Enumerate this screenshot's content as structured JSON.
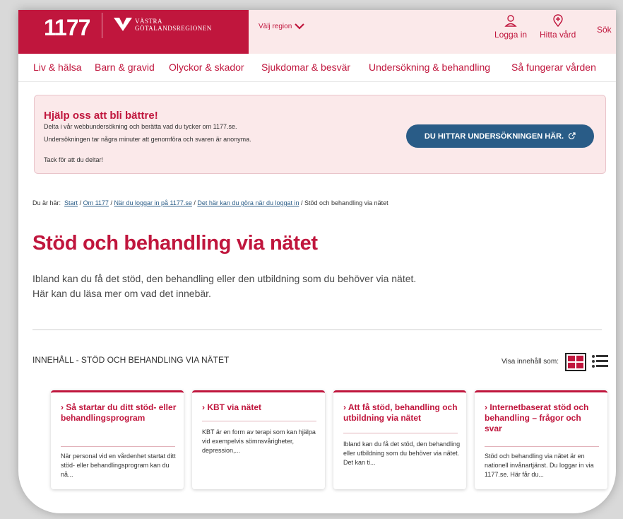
{
  "header": {
    "logo": "1177",
    "vgr_line1": "VÄSTRA",
    "vgr_line2": "GÖTALANDSREGIONEN",
    "region_label": "Välj region",
    "login_label": "Logga in",
    "find_care_label": "Hitta vård",
    "search_label": "Sök"
  },
  "nav": [
    "Liv & hälsa",
    "Barn & gravid",
    "Olyckor & skador",
    "Sjukdomar & besvär",
    "Undersökning & behandling",
    "Så fungerar vården"
  ],
  "survey": {
    "title": "Hjälp oss att bli bättre!",
    "line1": "Delta i vår webbundersökning och berätta vad du tycker om 1177.se.",
    "line2": "Undersökningen tar några minuter att genomföra och svaren är anonyma.",
    "line3": "Tack för att du deltar!",
    "button": "DU HITTAR UNDERSÖKNINGEN HÄR."
  },
  "breadcrumb": {
    "prefix": "Du är här:",
    "links": [
      "Start",
      "Om 1177",
      "När du loggar in på 1177.se",
      "Det här kan du göra när du loggat in"
    ],
    "current": "Stöd och behandling via nätet"
  },
  "page": {
    "title": "Stöd och behandling via nätet",
    "intro": "Ibland kan du få det stöd, den behandling eller den utbildning som du behöver via nätet. Här kan du läsa mer om vad det innebär."
  },
  "toc": {
    "heading": "INNEHÅLL - STÖD OCH BEHANDLING VIA NÄTET",
    "view_label": "Visa innehåll som:"
  },
  "cards": [
    {
      "title": "› Så startar du ditt stöd- eller behandlingsprogram",
      "text": "När personal vid en vårdenhet startat ditt stöd- eller behandlingsprogram kan du nå..."
    },
    {
      "title": "› KBT via nätet",
      "text": "KBT är en form av terapi som kan hjälpa vid exempelvis sömnsvårigheter, depression,..."
    },
    {
      "title": "› Att få stöd, behandling och utbildning via nätet",
      "text": "Ibland kan du få det stöd, den behandling eller utbildning som du behöver via nätet. Det kan ti..."
    },
    {
      "title": "› Internetbaserat stöd och behandling – frågor och svar",
      "text": "Stöd och behandling via nätet är en nationell invånartjänst. Du loggar in via 1177.se. Här får du..."
    }
  ],
  "colors": {
    "brand": "#c0163d",
    "link": "#295c87",
    "banner_bg": "#fbe9ea"
  }
}
